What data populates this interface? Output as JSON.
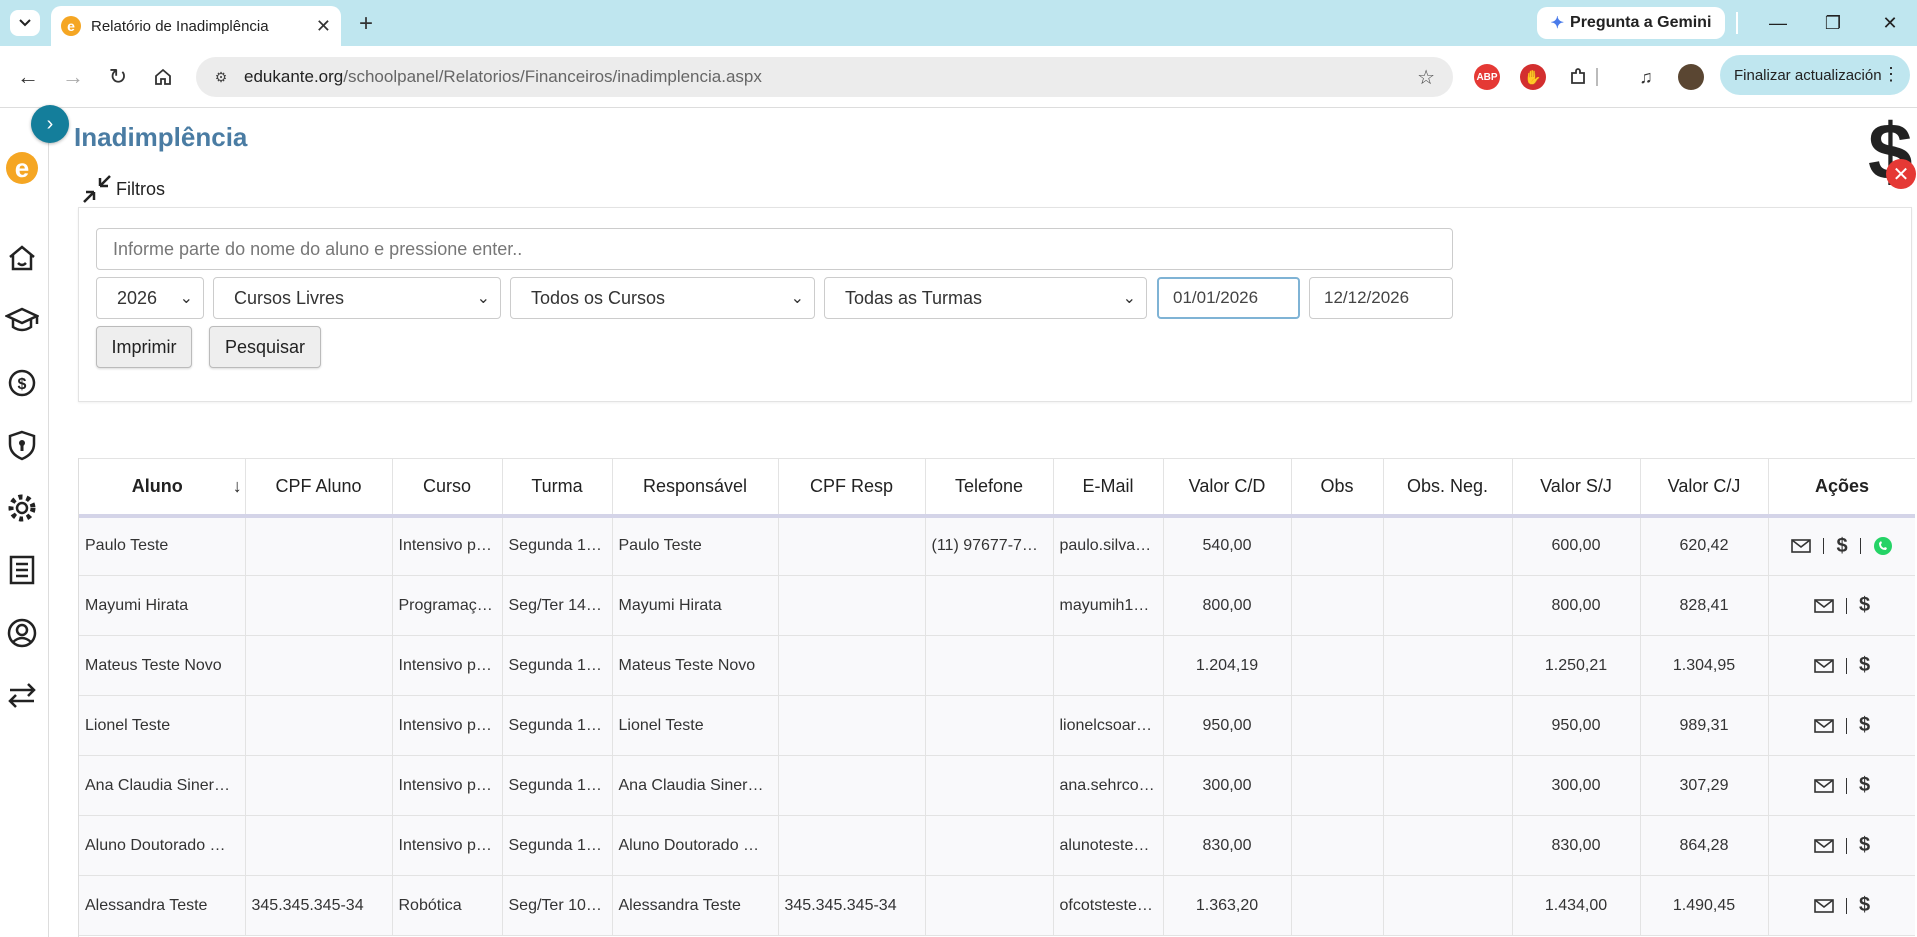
{
  "browser": {
    "tab_title": "Relatório de Inadimplência",
    "gemini_label": "Pregunta a Gemini",
    "url_host": "edukante.org",
    "url_path": "/schoolpanel/Relatorios/Financeiros/inadimplencia.aspx",
    "update_label": "Finalizar actualización"
  },
  "page": {
    "title": "Inadimplência",
    "filters_label": "Filtros"
  },
  "filters": {
    "search_placeholder": "Informe parte do nome do aluno e pressione enter..",
    "year": "2026",
    "course_type": "Cursos Livres",
    "course": "Todos os Cursos",
    "class": "Todas as Turmas",
    "date_from": "01/01/2026",
    "date_to": "12/12/2026",
    "print_label": "Imprimir",
    "search_label": "Pesquisar"
  },
  "table": {
    "headers": [
      "Aluno",
      "CPF Aluno",
      "Curso",
      "Turma",
      "Responsável",
      "CPF Resp",
      "Telefone",
      "E-Mail",
      "Valor C/D",
      "Obs",
      "Obs. Neg.",
      "Valor S/J",
      "Valor C/J",
      "Ações"
    ],
    "rows": [
      {
        "aluno": "Paulo Teste",
        "cpf": "",
        "curso": "Intensivo p…",
        "turma": "Segunda 1…",
        "resp": "Paulo Teste",
        "cpf_resp": "",
        "telefone": "(11) 97677-7…",
        "email": "paulo.silva…",
        "valor_cd": "540,00",
        "obs": "",
        "obs_neg": "",
        "valor_sj": "600,00",
        "valor_cj": "620,42",
        "whatsapp": true
      },
      {
        "aluno": "Mayumi Hirata",
        "cpf": "",
        "curso": "Programaç…",
        "turma": "Seg/Ter 14…",
        "resp": "Mayumi Hirata",
        "cpf_resp": "",
        "telefone": "",
        "email": "mayumih1…",
        "valor_cd": "800,00",
        "obs": "",
        "obs_neg": "",
        "valor_sj": "800,00",
        "valor_cj": "828,41",
        "whatsapp": false
      },
      {
        "aluno": "Mateus Teste Novo",
        "cpf": "",
        "curso": "Intensivo p…",
        "turma": "Segunda 1…",
        "resp": "Mateus Teste Novo",
        "cpf_resp": "",
        "telefone": "",
        "email": "",
        "valor_cd": "1.204,19",
        "obs": "",
        "obs_neg": "",
        "valor_sj": "1.250,21",
        "valor_cj": "1.304,95",
        "whatsapp": false
      },
      {
        "aluno": "Lionel Teste",
        "cpf": "",
        "curso": "Intensivo p…",
        "turma": "Segunda 1…",
        "resp": "Lionel Teste",
        "cpf_resp": "",
        "telefone": "",
        "email": "lionelcsoar…",
        "valor_cd": "950,00",
        "obs": "",
        "obs_neg": "",
        "valor_sj": "950,00",
        "valor_cj": "989,31",
        "whatsapp": false
      },
      {
        "aluno": "Ana Claudia Siner…",
        "cpf": "",
        "curso": "Intensivo p…",
        "turma": "Segunda 1…",
        "resp": "Ana Claudia Siner…",
        "cpf_resp": "",
        "telefone": "",
        "email": "ana.sehrco…",
        "valor_cd": "300,00",
        "obs": "",
        "obs_neg": "",
        "valor_sj": "300,00",
        "valor_cj": "307,29",
        "whatsapp": false
      },
      {
        "aluno": "Aluno Doutorado …",
        "cpf": "",
        "curso": "Intensivo p…",
        "turma": "Segunda 1…",
        "resp": "Aluno Doutorado …",
        "cpf_resp": "",
        "telefone": "",
        "email": "alunoteste…",
        "valor_cd": "830,00",
        "obs": "",
        "obs_neg": "",
        "valor_sj": "830,00",
        "valor_cj": "864,28",
        "whatsapp": false
      },
      {
        "aluno": "Alessandra Teste",
        "cpf": "345.345.345-34",
        "curso": "Robótica",
        "turma": "Seg/Ter 10…",
        "resp": "Alessandra Teste",
        "cpf_resp": "345.345.345-34",
        "telefone": "",
        "email": "ofcotsteste…",
        "valor_cd": "1.363,20",
        "obs": "",
        "obs_neg": "",
        "valor_sj": "1.434,00",
        "valor_cj": "1.490,45",
        "whatsapp": false
      }
    ]
  },
  "colors": {
    "accent": "#147e9b",
    "title": "#4a7ca3",
    "brand_orange": "#f5a623",
    "whatsapp": "#25d366",
    "danger": "#e53935"
  }
}
